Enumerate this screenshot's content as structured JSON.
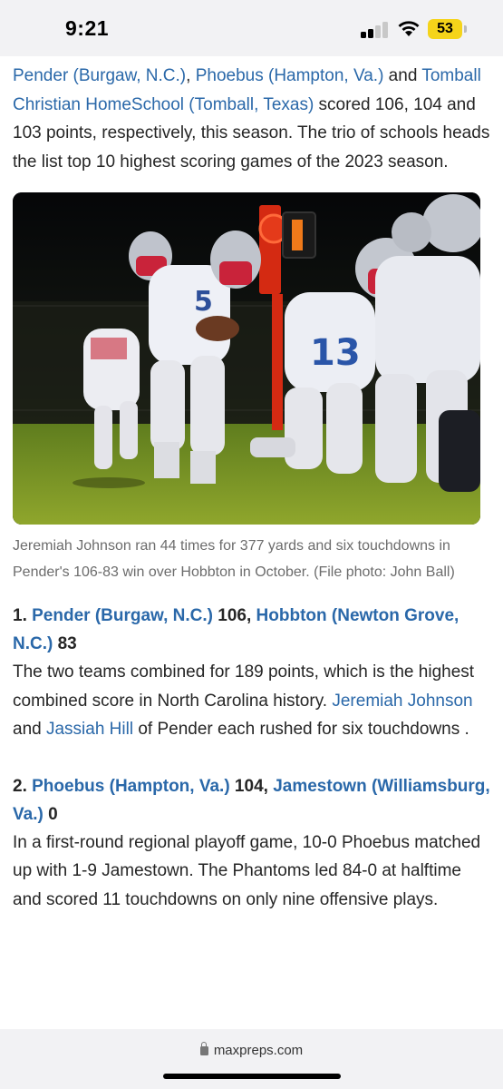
{
  "status_bar": {
    "time": "9:21",
    "battery": "53",
    "battery_color": "#f5d41a"
  },
  "intro": {
    "link1": "Pender (Burgaw, N.C.)",
    "sep1": ", ",
    "link2": "Phoebus (Hampton, Va.)",
    "sep2": " and ",
    "link3": "Tomball Christian HomeSchool (Tomball, Texas)",
    "text": " scored 106, 104 and 103 points, respectively, this season. The trio of schools heads the list top 10 highest scoring games of the 2023 season."
  },
  "photo": {
    "icon": "football-photo",
    "caption": "Jeremiah Johnson ran 44 times for 377 yards and six touchdowns in Pender's 106-83 win over Hobbton in October. (File photo: John Ball)"
  },
  "entries": [
    {
      "rank": "1. ",
      "team1": "Pender (Burgaw, N.C.)",
      "score1": " 106, ",
      "team2": "Hobbton (Newton Grove, N.C.)",
      "score2": " 83",
      "body_pre": "The two teams combined for 189 points, which is the highest combined score in North Carolina history. ",
      "player1": "Jeremiah Johnson",
      "body_mid": " and ",
      "player2": "Jassiah Hill",
      "body_post": " of Pender each rushed for six touchdowns ."
    },
    {
      "rank": "2. ",
      "team1": "Phoebus (Hampton, Va.)",
      "score1": " 104, ",
      "team2": "Jamestown (Williamsburg, Va.)",
      "score2": " 0",
      "body": "In a first-round regional playoff game, 10-0 Phoebus matched up with 1-9 Jamestown. The Phantoms led 84-0 at halftime and scored 11 touchdowns on only nine offensive plays."
    }
  ],
  "browser": {
    "url": "maxpreps.com"
  },
  "colors": {
    "link": "#2a68a9",
    "text": "#262626",
    "caption": "#6c6c6c"
  }
}
